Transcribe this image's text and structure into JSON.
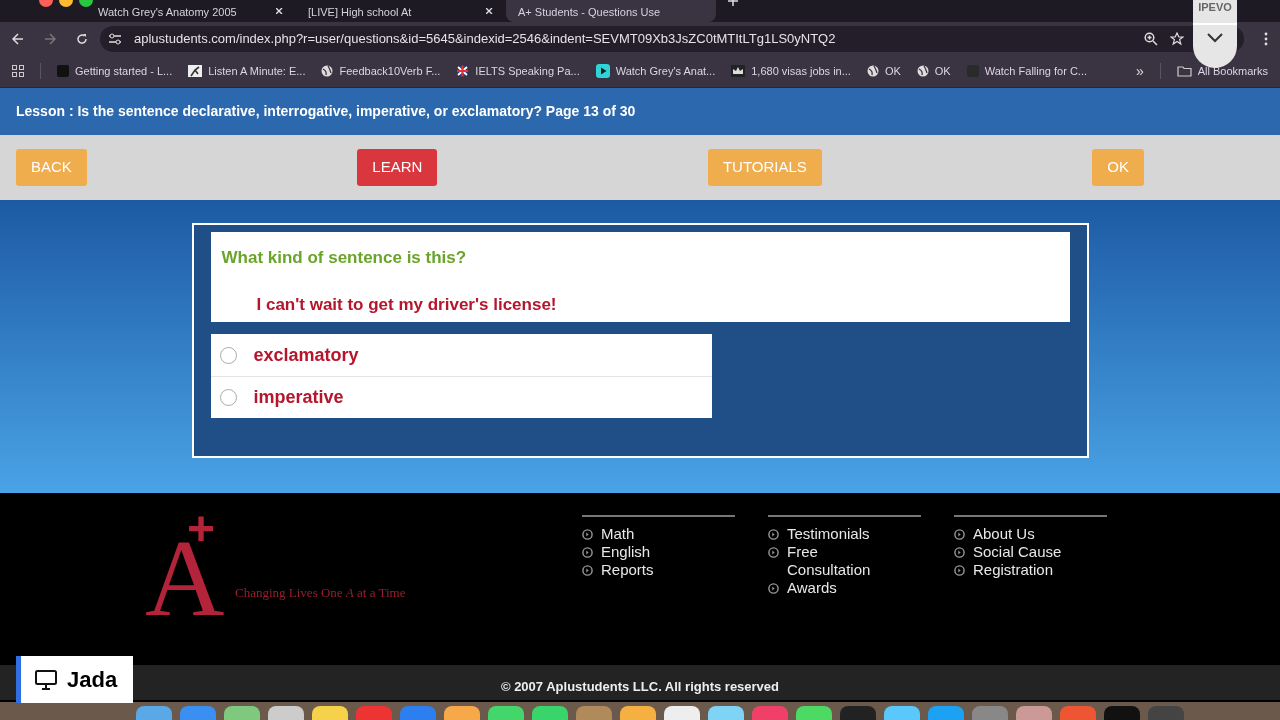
{
  "browser": {
    "tabs": [
      {
        "title": "Watch Grey's Anatomy 2005",
        "selected": false
      },
      {
        "title": "[LIVE] High school At",
        "selected": false
      },
      {
        "title": "A+ Students - Questions Use",
        "selected": true
      }
    ],
    "url": "aplustudents.com/index.php?r=user/questions&id=5645&indexid=2546&indent=SEVMT09Xb3JsZC0tMTItLTg1LS0yNTQ2",
    "bookmarks": [
      "Getting started - L...",
      "Listen A Minute: E...",
      "Feedback10Verb F...",
      "IELTS Speaking Pa...",
      "Watch Grey's Anat...",
      "1,680 visas jobs in...",
      "OK",
      "OK",
      "Watch Falling for C..."
    ],
    "more": "»",
    "all_bookmarks": "All Bookmarks"
  },
  "camera_widget": {
    "label": "IPEVO"
  },
  "lesson_title": "Lesson : Is the sentence declarative, interrogative, imperative, or exclamatory? Page 13 of 30",
  "nav_buttons": [
    {
      "label": "BACK",
      "kind": "orange"
    },
    {
      "label": "LEARN",
      "kind": "red"
    },
    {
      "label": "TUTORIALS",
      "kind": "orange"
    },
    {
      "label": "OK",
      "kind": "orange"
    }
  ],
  "question": {
    "prompt": "What kind of sentence is this?",
    "sentence": "I can't wait to get my driver's license!",
    "options": [
      {
        "label": "exclamatory",
        "selected": false
      },
      {
        "label": "imperative",
        "selected": false
      }
    ]
  },
  "footer": {
    "logo": {
      "letter": "A",
      "mark": "+",
      "tagline": "Changing Lives One *A* at a Time"
    },
    "columns": [
      [
        "Math",
        "English",
        "Reports"
      ],
      [
        "Testimonials",
        "Free Consultation",
        "Awards"
      ],
      [
        "About Us",
        "Social Cause",
        "Registration"
      ]
    ],
    "copyright": "© 2007 Aplustudents LLC. All rights reserved"
  },
  "presenter": {
    "name": "Jada"
  }
}
